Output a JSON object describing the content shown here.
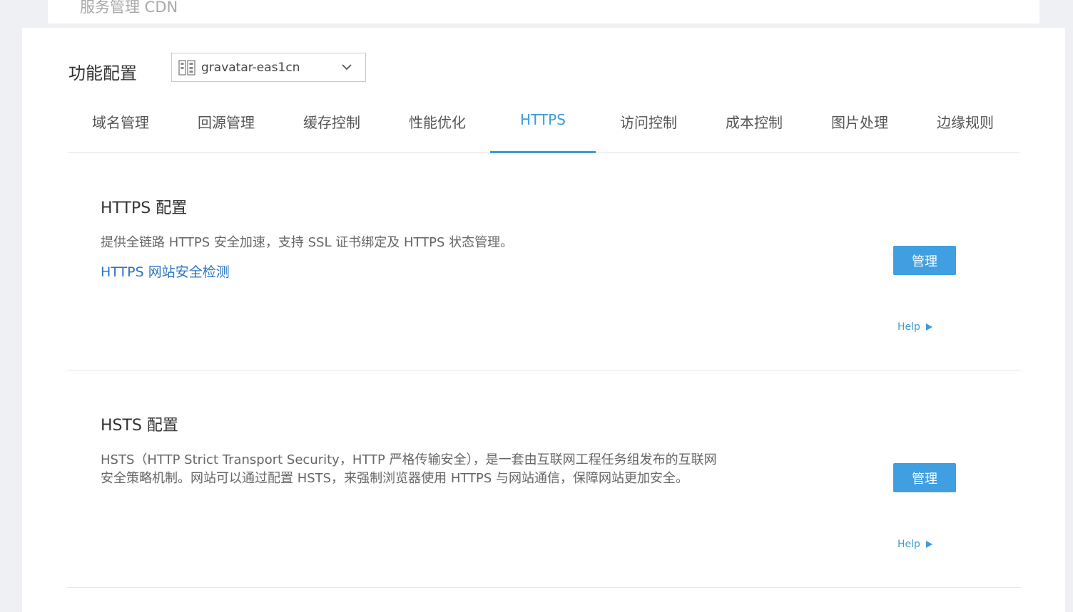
{
  "header": {
    "breadcrumb": "服务管理 CDN"
  },
  "config": {
    "label": "功能配置",
    "domain_selected": "gravatar-eas1cn"
  },
  "tabs": [
    {
      "label": "域名管理",
      "active": false
    },
    {
      "label": "回源管理",
      "active": false
    },
    {
      "label": "缓存控制",
      "active": false
    },
    {
      "label": "性能优化",
      "active": false
    },
    {
      "label": "HTTPS",
      "active": true
    },
    {
      "label": "访问控制",
      "active": false
    },
    {
      "label": "成本控制",
      "active": false
    },
    {
      "label": "图片处理",
      "active": false
    },
    {
      "label": "边缘规则",
      "active": false
    }
  ],
  "sections": {
    "https": {
      "title": "HTTPS 配置",
      "description": "提供全链路 HTTPS 安全加速，支持 SSL 证书绑定及 HTTPS 状态管理。",
      "link": "HTTPS 网站安全检测",
      "button": "管理",
      "help": "Help"
    },
    "hsts": {
      "title": "HSTS 配置",
      "description_line1": "HSTS（HTTP Strict Transport Security，HTTP 严格传输安全），是一套由互联网工程任务组发布的互联网",
      "description_line2": "安全策略机制。网站可以通过配置 HSTS，来强制浏览器使用 HTTPS 与网站通信，保障网站更加安全。",
      "button": "管理",
      "help": "Help"
    }
  },
  "colors": {
    "accent": "#3b9cd9",
    "button": "#3f9fe0",
    "link": "#2b74c7",
    "background": "#eef0f3"
  },
  "icons": {
    "domain": "domain-icon",
    "dropdown": "chevron-down-icon",
    "help": "triangle-right-icon"
  }
}
